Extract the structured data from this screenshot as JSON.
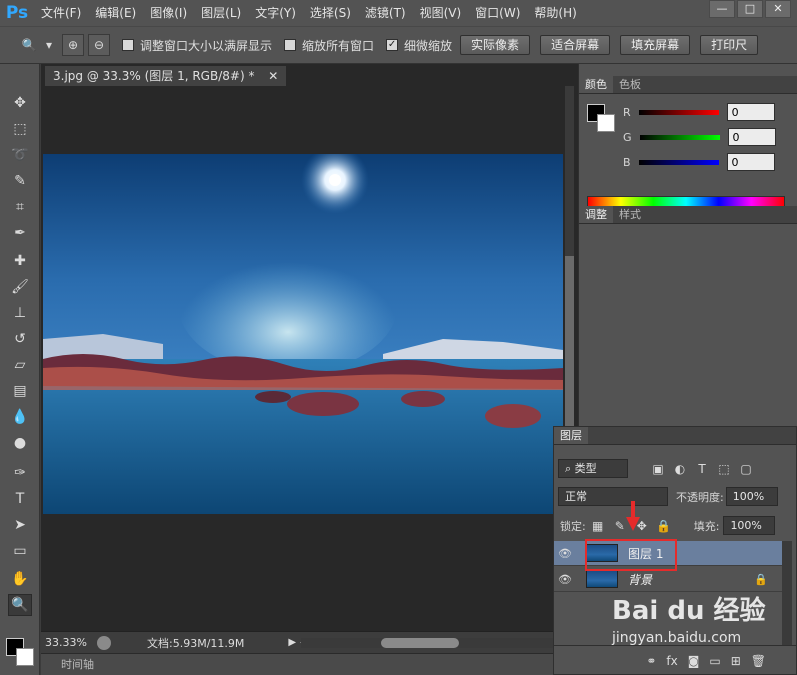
{
  "menubar": {
    "logo": "Ps",
    "items": [
      "文件(F)",
      "编辑(E)",
      "图像(I)",
      "图层(L)",
      "文字(Y)",
      "选择(S)",
      "滤镜(T)",
      "视图(V)",
      "窗口(W)",
      "帮助(H)"
    ],
    "window_controls": [
      "—",
      "□",
      "✕"
    ]
  },
  "options": {
    "check1": "调整窗口大小以满屏显示",
    "check2": "缩放所有窗口",
    "check3": "细微缩放",
    "btn_actual": "实际像素",
    "btn_fit": "适合屏幕",
    "btn_fill": "填充屏幕",
    "btn_print": "打印尺"
  },
  "document": {
    "tab_title": "3.jpg @ 33.3% (图层 1, RGB/8#) *",
    "zoom": "33.33%",
    "doc_info": "文档:5.93M/11.9M",
    "timeline": "时间轴"
  },
  "color_panel": {
    "tabs": [
      "颜色",
      "色板"
    ],
    "r_label": "R",
    "g_label": "G",
    "b_label": "B",
    "r_val": "0",
    "g_val": "0",
    "b_val": "0"
  },
  "adjust_panel": {
    "tabs": [
      "调整",
      "样式"
    ]
  },
  "layers_panel": {
    "tab": "图层",
    "filter_label": "类型",
    "blend_mode": "正常",
    "opacity_label": "不透明度:",
    "opacity_val": "100%",
    "lock_label": "锁定:",
    "fill_label": "填充:",
    "fill_val": "100%",
    "layers": [
      {
        "name": "图层 1"
      },
      {
        "name": "背景"
      }
    ]
  },
  "watermark": {
    "brand": "Bai du 经验",
    "url": "jingyan.baidu.com"
  }
}
